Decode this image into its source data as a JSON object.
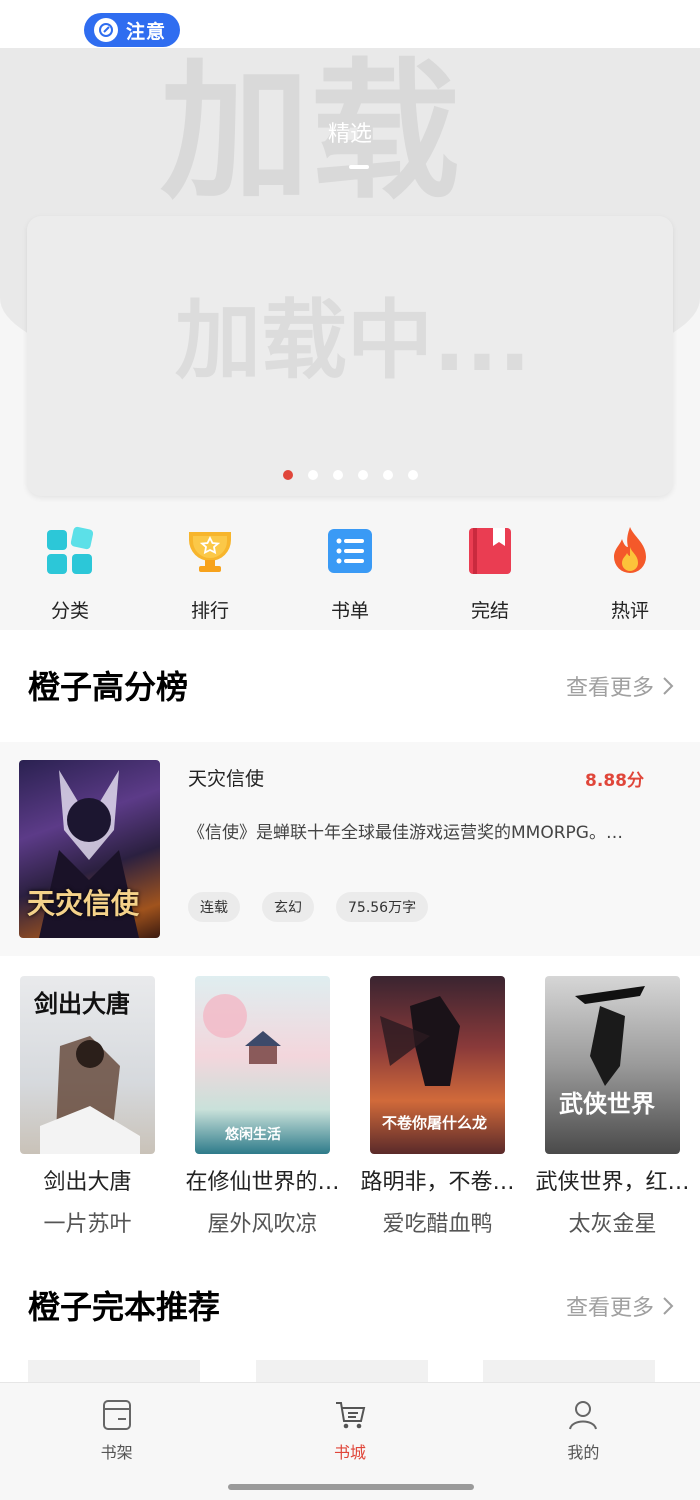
{
  "status_bar": {
    "notice_label": "注意"
  },
  "hero": {
    "watermark": "加载",
    "tab_label": "精选",
    "banner_watermark": "加载中...",
    "carousel_pages": 6,
    "carousel_active": 0
  },
  "quick_menu": [
    {
      "label": "分类",
      "icon": "category-icon"
    },
    {
      "label": "排行",
      "icon": "trophy-icon"
    },
    {
      "label": "书单",
      "icon": "list-icon"
    },
    {
      "label": "完结",
      "icon": "bookmark-book-icon"
    },
    {
      "label": "热评",
      "icon": "fire-icon"
    }
  ],
  "section_top": {
    "title": "橙子高分榜",
    "more_label": "查看更多"
  },
  "featured": {
    "title": "天灾信使",
    "score": "8.88分",
    "description": "《信使》是蝉联十年全球最佳游戏运营奖的MMORPG。…",
    "tags": [
      "连载",
      "玄幻",
      "75.56万字"
    ],
    "cover_text": "天灾信使"
  },
  "books": [
    {
      "title": "剑出大唐",
      "author": "一片苏叶",
      "cover_text": "剑出大唐"
    },
    {
      "title": "在修仙世界的…",
      "author": "屋外风吹凉",
      "cover_text": "悠闲生活"
    },
    {
      "title": "路明非，不卷…",
      "author": "爱吃醋血鸭",
      "cover_text": "不卷你屠什么龙"
    },
    {
      "title": "武侠世界，红…",
      "author": "太灰金星",
      "cover_text": "武侠世界"
    }
  ],
  "section_complete": {
    "title": "橙子完本推荐",
    "more_label": "查看更多"
  },
  "bottom_nav": [
    {
      "label": "书架",
      "icon": "bookshelf-icon",
      "active": false
    },
    {
      "label": "书城",
      "icon": "cart-icon",
      "active": true
    },
    {
      "label": "我的",
      "icon": "user-icon",
      "active": false
    }
  ],
  "colors": {
    "accent": "#e0463a",
    "notice": "#2f6df0"
  }
}
